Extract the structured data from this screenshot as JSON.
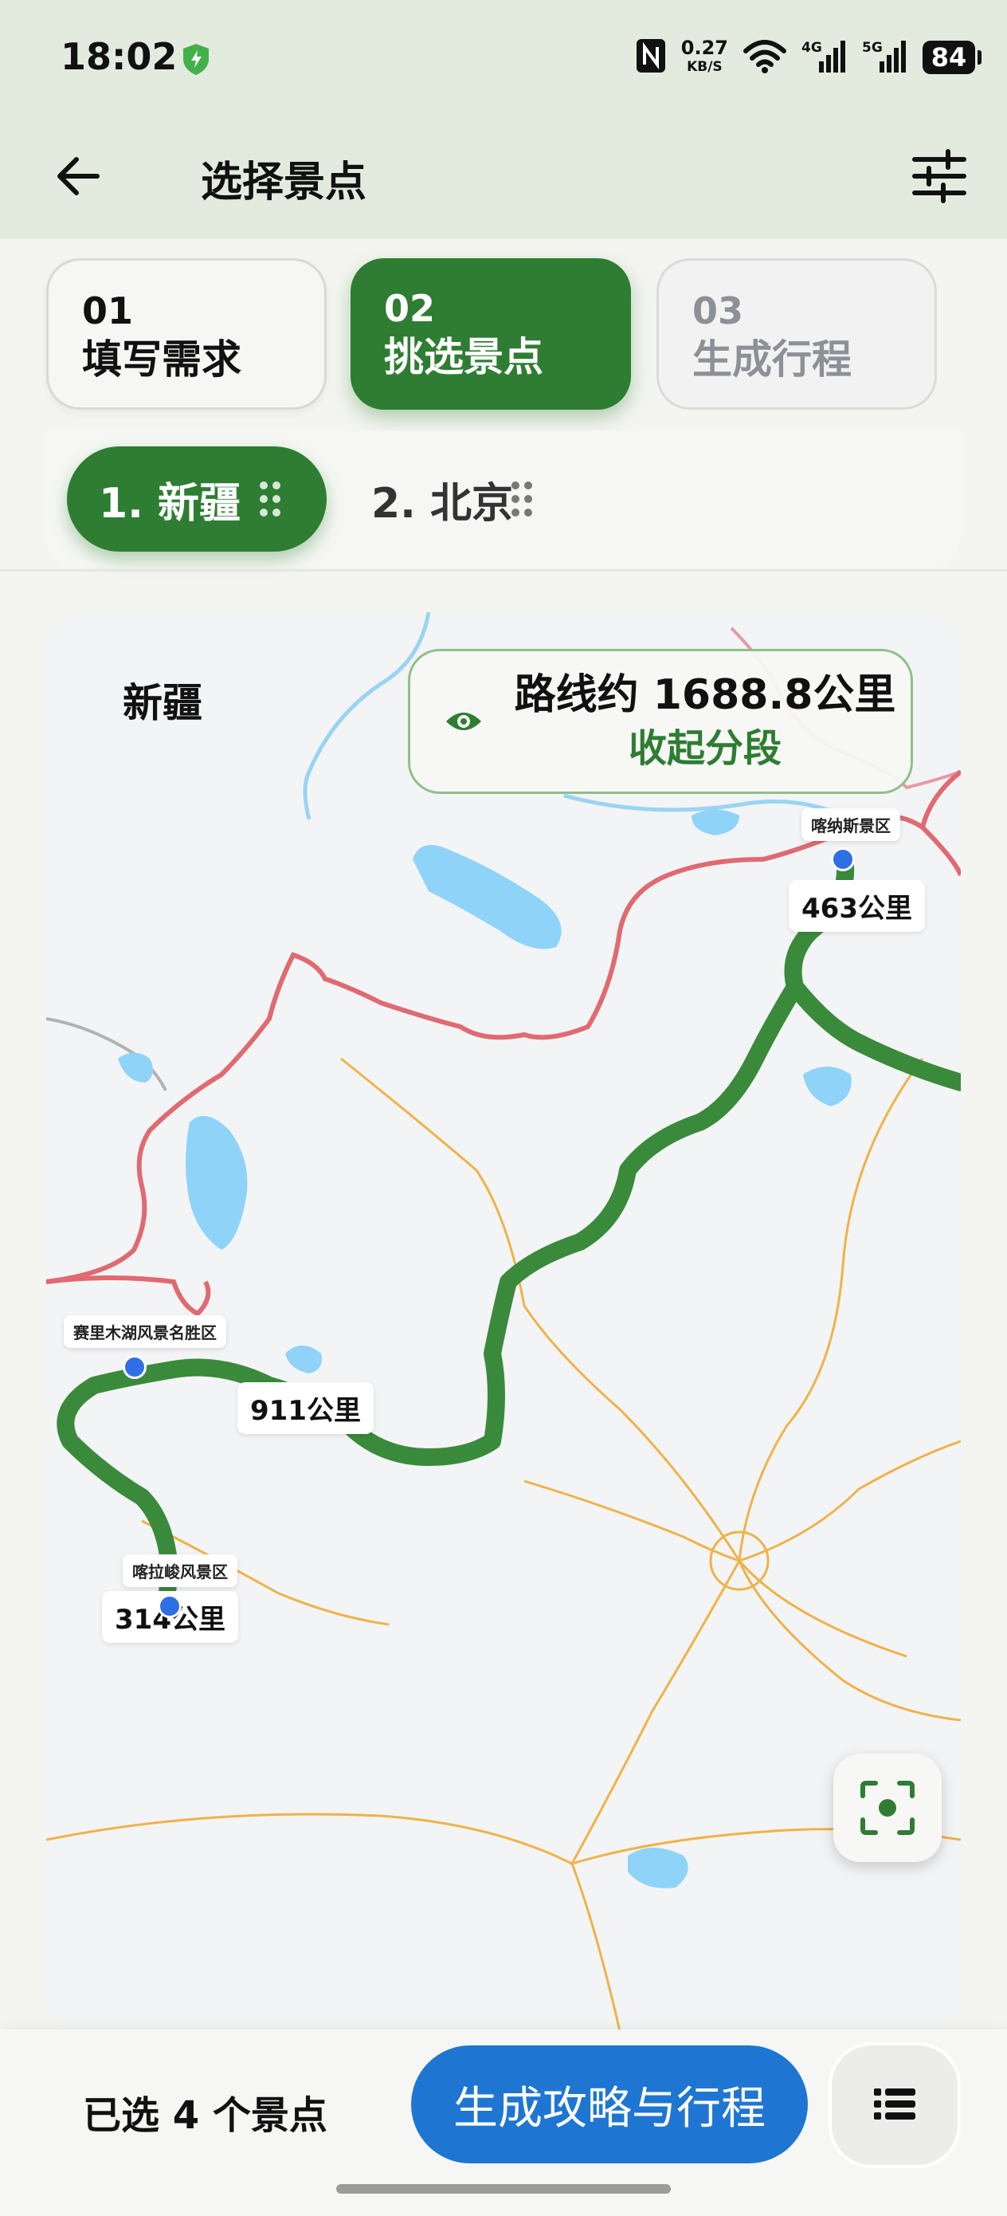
{
  "status_bar": {
    "time": "18:02",
    "net_speed": "0.27",
    "net_unit": "KB/S",
    "sig1": "4G",
    "sig2": "5G",
    "battery": "84"
  },
  "header": {
    "title": "选择景点"
  },
  "steps": [
    {
      "num": "01",
      "label": "填写需求",
      "state": "done"
    },
    {
      "num": "02",
      "label": "挑选景点",
      "state": "active"
    },
    {
      "num": "03",
      "label": "生成行程",
      "state": "pending"
    }
  ],
  "regions": [
    {
      "label": "1. 新疆",
      "active": true
    },
    {
      "label": "2. 北京",
      "active": false
    }
  ],
  "map": {
    "region_label": "新疆",
    "route_summary": "路线约 1688.8公里",
    "route_toggle": "收起分段",
    "pois": [
      {
        "name": "喀纳斯景区"
      },
      {
        "name": "赛里木湖风景名胜区"
      },
      {
        "name": "喀拉峻风景区"
      }
    ],
    "distances": [
      "463公里",
      "911公里",
      "314公里"
    ],
    "colors": {
      "route": "#3a8a3c",
      "border": "#e06a72",
      "road": "#f0b24a",
      "water": "#8fd3f8",
      "poi": "#2f6fe6"
    }
  },
  "bottom": {
    "selected_text": "已选 4 个景点",
    "generate_label": "生成攻略与行程"
  },
  "colors": {
    "accent": "#2e7d32",
    "primary_button": "#1f76d2"
  }
}
